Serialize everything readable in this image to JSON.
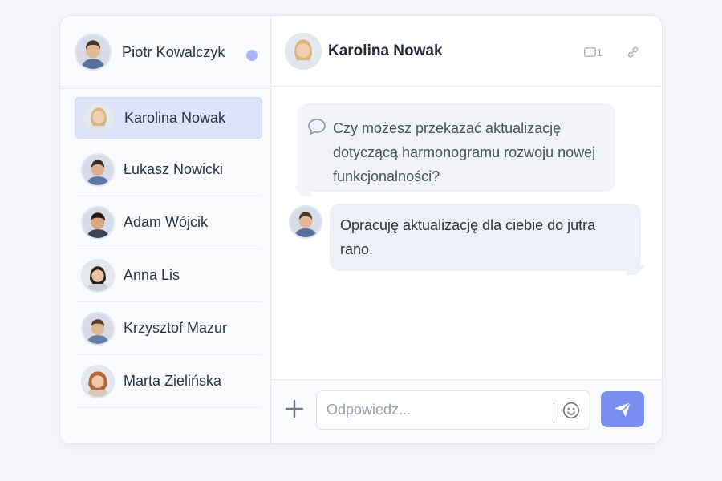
{
  "current_user": {
    "name": "Piotr Kowalczyk",
    "status": "online"
  },
  "contacts": [
    {
      "name": "Karolina Nowak",
      "active": true
    },
    {
      "name": "Łukasz Nowicki",
      "active": false
    },
    {
      "name": "Adam Wójcik",
      "active": false
    },
    {
      "name": "Anna Lis",
      "active": false
    },
    {
      "name": "Krzysztof Mazur",
      "active": false
    },
    {
      "name": "Marta Zielińska",
      "active": false
    }
  ],
  "chat": {
    "title": "Karolina Nowak",
    "header_icons": [
      "video-icon",
      "link-icon"
    ],
    "video_count": "1",
    "messages": [
      {
        "from": "Karolina Nowak",
        "direction": "incoming",
        "text": "Czy możesz przekazać aktualizację dotyczącą harmonogramu rozwoju nowej funkcjonalności?"
      },
      {
        "from": "Piotr Kowalczyk",
        "direction": "outgoing",
        "text": "Opracuję aktualizację dla ciebie do jutra rano."
      }
    ]
  },
  "composer": {
    "placeholder": "Odpowiedz...",
    "value": "",
    "icons": [
      "plus-icon",
      "emoji-icon",
      "send-icon"
    ]
  },
  "colors": {
    "accent": "#7b8ff0",
    "active_contact_bg": "#dce3fa",
    "status_dot": "#a8b7f0",
    "bubble_bg": "#f1f3f9"
  }
}
